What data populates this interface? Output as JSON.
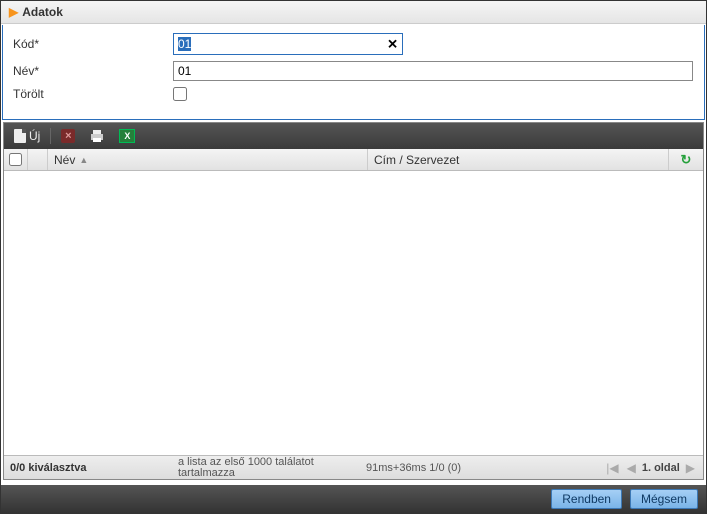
{
  "section": {
    "title": "Adatok"
  },
  "form": {
    "kod_label": "Kód*",
    "kod_value": "01",
    "nev_label": "Név*",
    "nev_value": "01",
    "torolt_label": "Törölt",
    "torolt_checked": false
  },
  "toolbar": {
    "uj_label": "Új"
  },
  "grid": {
    "columns": {
      "nev": "Név",
      "cim": "Cím / Szervezet"
    },
    "rows": []
  },
  "status": {
    "selection": "0/0 kiválasztva",
    "note": "a lista az első 1000 találatot tartalmazza",
    "timing": "91ms+36ms 1/0 (0)",
    "page_label": "1. oldal"
  },
  "footer": {
    "ok": "Rendben",
    "cancel": "Mégsem"
  }
}
